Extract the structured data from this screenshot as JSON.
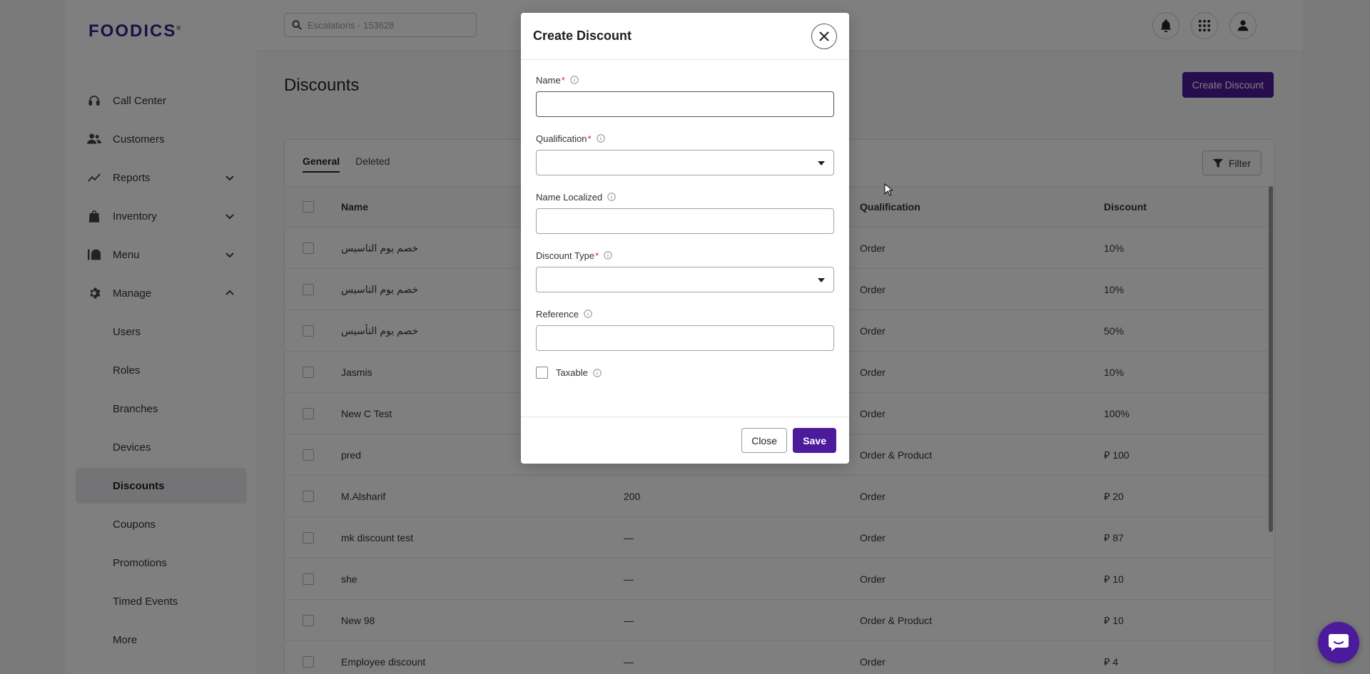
{
  "brand": {
    "logo": "FOODICS",
    "logo_mark": "®"
  },
  "search": {
    "placeholder": "Escalations - 153628"
  },
  "sidebar": {
    "items": [
      {
        "label": "Call Center"
      },
      {
        "label": "Customers"
      },
      {
        "label": "Reports"
      },
      {
        "label": "Inventory"
      },
      {
        "label": "Menu"
      },
      {
        "label": "Manage"
      }
    ],
    "sub_items": [
      {
        "label": "Users"
      },
      {
        "label": "Roles"
      },
      {
        "label": "Branches"
      },
      {
        "label": "Devices"
      },
      {
        "label": "Discounts"
      },
      {
        "label": "Coupons"
      },
      {
        "label": "Promotions"
      },
      {
        "label": "Timed Events"
      },
      {
        "label": "More"
      }
    ]
  },
  "page": {
    "title": "Discounts",
    "create_button": "Create Discount",
    "tabs": [
      {
        "label": "General"
      },
      {
        "label": "Deleted"
      }
    ],
    "filter_label": "Filter"
  },
  "table": {
    "headers": {
      "name": "Name",
      "qualification": "Qualification",
      "discount": "Discount"
    },
    "rows": [
      {
        "name": "خصم يوم التاسيس",
        "mid": "",
        "qualification": "Order",
        "discount": "10%"
      },
      {
        "name": "خصم يوم التاسيس",
        "mid": "",
        "qualification": "Order",
        "discount": "10%"
      },
      {
        "name": "خصم يوم التأسيس",
        "mid": "",
        "qualification": "Order",
        "discount": "50%"
      },
      {
        "name": "Jasmis",
        "mid": "",
        "qualification": "Order",
        "discount": "10%"
      },
      {
        "name": "New C Test",
        "mid": "",
        "qualification": "Order",
        "discount": "100%"
      },
      {
        "name": "pred",
        "mid": "",
        "qualification": "Order & Product",
        "discount": "⃁ 100"
      },
      {
        "name": "M.Alsharif",
        "mid": "200",
        "qualification": "Order",
        "discount": "⃁ 20"
      },
      {
        "name": "mk discount test",
        "mid": "—",
        "qualification": "Order",
        "discount": "⃁ 87"
      },
      {
        "name": "she",
        "mid": "—",
        "qualification": "Order",
        "discount": "⃁ 10"
      },
      {
        "name": "New 98",
        "mid": "—",
        "qualification": "Order & Product",
        "discount": "⃁ 10"
      },
      {
        "name": "Employee discount",
        "mid": "—",
        "qualification": "Order",
        "discount": "⃁ 4"
      }
    ]
  },
  "modal": {
    "title": "Create Discount",
    "fields": {
      "name": {
        "label": "Name",
        "required": "*",
        "value": ""
      },
      "qualification": {
        "label": "Qualification",
        "required": "*",
        "value": ""
      },
      "name_localized": {
        "label": "Name Localized",
        "value": ""
      },
      "discount_type": {
        "label": "Discount Type",
        "required": "*",
        "value": ""
      },
      "reference": {
        "label": "Reference",
        "value": ""
      },
      "taxable": {
        "label": "Taxable"
      }
    },
    "close_label": "Close",
    "save_label": "Save"
  },
  "colors": {
    "brand": "#4b1b9c",
    "required": "#d0312d"
  },
  "icons": {
    "nav": [
      "headset-icon",
      "users-icon",
      "chart-line-icon",
      "bag-icon",
      "menu-food-icon",
      "gear-icon"
    ],
    "top": [
      "bell-icon",
      "apps-grid-icon",
      "user-icon"
    ]
  }
}
